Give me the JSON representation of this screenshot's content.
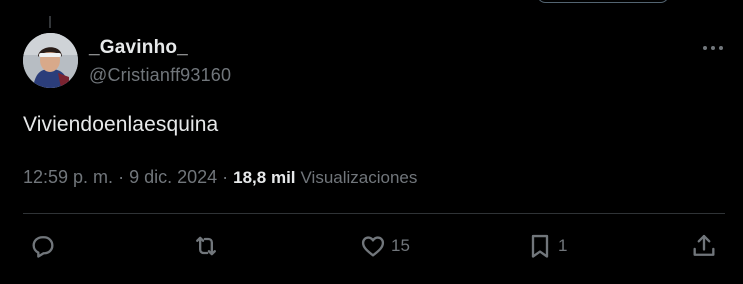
{
  "author": {
    "display_name": "_Gavinho_",
    "handle": "@Cristianff93160"
  },
  "tweet": {
    "text": "Viviendoenlaesquina"
  },
  "meta": {
    "time": "12:59 p. m.",
    "separator": "·",
    "date": "9 dic. 2024",
    "views_count": "18,8 mil",
    "views_label": "Visualizaciones"
  },
  "actions": {
    "reply": {
      "icon": "reply-icon",
      "count": ""
    },
    "retweet": {
      "icon": "retweet-icon",
      "count": ""
    },
    "like": {
      "icon": "heart-icon",
      "count": "15"
    },
    "bookmark": {
      "icon": "bookmark-icon",
      "count": "1"
    },
    "share": {
      "icon": "share-icon",
      "count": ""
    }
  },
  "colors": {
    "background": "#000000",
    "primary_text": "#e7e9ea",
    "secondary_text": "#71767b",
    "divider": "#2f3336"
  }
}
